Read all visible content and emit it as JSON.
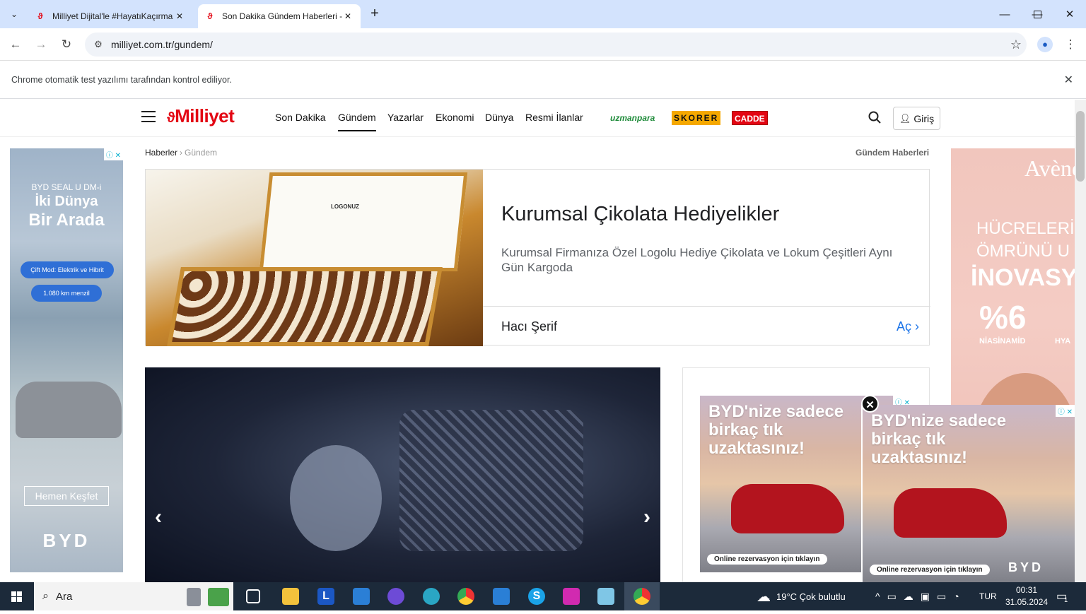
{
  "browser": {
    "tabs": [
      {
        "title": "Milliyet Dijital'le #HayatıKaçırma",
        "active": false
      },
      {
        "title": "Son Dakika Gündem Haberleri -",
        "active": true
      }
    ],
    "url": "milliyet.com.tr/gundem/",
    "infobar_message": "Chrome otomatik test yazılımı tarafından kontrol ediliyor."
  },
  "site": {
    "logo": "Milliyet",
    "nav": [
      "Son Dakika",
      "Gündem",
      "Yazarlar",
      "Ekonomi",
      "Dünya",
      "Resmi İlanlar"
    ],
    "active_nav": "Gündem",
    "brands": [
      "uzmanpara",
      "SKORER",
      "CADDE"
    ],
    "login_label": "Giriş",
    "breadcrumb": {
      "root": "Haberler",
      "current": "Gündem"
    },
    "section_label": "Gündem Haberleri"
  },
  "ads": {
    "left": {
      "line1": "BYD SEAL U DM-i",
      "line2": "İki Dünya",
      "line3": "Bir Arada",
      "pill1": "Çift Mod: Elektrik ve Hibrit",
      "pill2": "1.080 km menzil",
      "cta": "Hemen Keşfet",
      "brand": "BYD"
    },
    "right": {
      "brand": "Avène",
      "line1": "HÜCRELERİN",
      "line2": "ÖMRÜNÜ U",
      "line3": "İNOVASY",
      "pct": "%6",
      "label": "NİASİNAMİD",
      "label2": "HYA"
    },
    "banner": {
      "box_brand": "LOGONUZ",
      "title": "Kurumsal Çikolata Hediyelikler",
      "description": "Kurumsal Firmanıza Özel Logolu Hediye Çikolata ve Lokum Çeşitleri Aynı Gün Kargoda",
      "advertiser": "Hacı Şerif",
      "open_label": "Aç"
    },
    "car": {
      "headline": "BYD'nize sadece birkaç tık uzaktasınız!",
      "cta": "Online rezervasyon için tıklayın",
      "brand": "BYD"
    }
  },
  "taskbar": {
    "search_placeholder": "Ara",
    "weather": "19°C  Çok bulutlu",
    "language": "TUR",
    "time": "00:31",
    "date": "31.05.2024",
    "notifications": "1"
  }
}
